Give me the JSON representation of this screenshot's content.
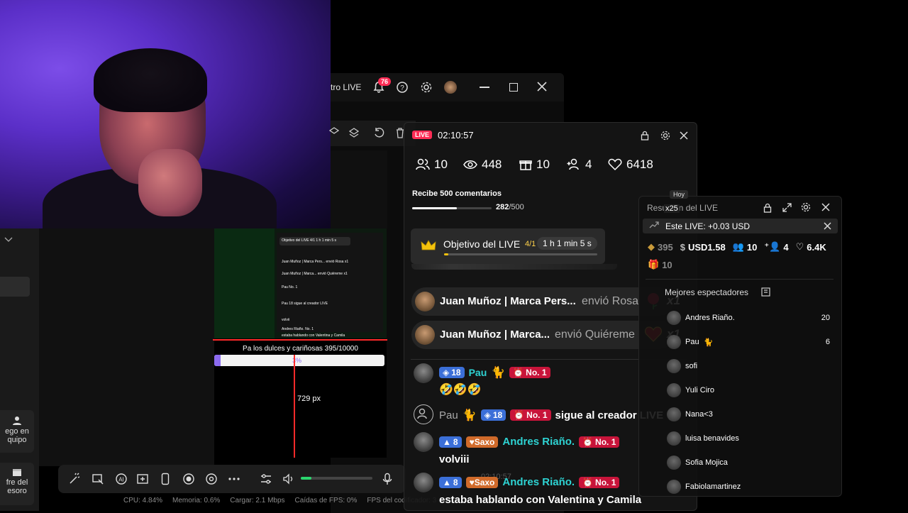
{
  "studio": {
    "topbar_title": "tro LIVE",
    "notification_count": "76"
  },
  "left_panel": {
    "btn_game": "ego en quipo",
    "btn_treasure": "fre del esoro"
  },
  "preview": {
    "goal_text": "Pa los dulces y cariñosas 395/10000",
    "goal_pct": "3%",
    "px_label": "729 px",
    "mini_chat": [
      "Objetivo del LIVE 4/1 1 h 1 min 5 s",
      "Juan Muñoz | Marca Pers... envió Rosa x1",
      "Juan Muñoz | Marca... envió Quiéreme x1",
      "Pau No. 1",
      "Pau 18 sigue al creador LIVE",
      "volvii",
      "Andres Riaño. No. 1",
      "estaba hablando con Valentina y Camila"
    ]
  },
  "status_bar": {
    "cpu": "CPU: 4.84%",
    "memory": "Memoria: 0.6%",
    "upload": "Cargar: 2.1 Mbps",
    "fps_drops": "Caídas de FPS: 0%",
    "encoder_fps": "FPS del codificador: 3"
  },
  "stats_overlay": {
    "live_label": "LIVE",
    "timer": "02:10:57",
    "viewers": "10",
    "views": "448",
    "gifts": "10",
    "followers": "4",
    "likes": "6418",
    "goal_title": "Recibe 500 comentarios",
    "goal_progress": "282",
    "goal_total": "/500",
    "goal_fraction": 0.564,
    "objective_label": "Objetivo del LIVE",
    "objective_count": "4/1",
    "objective_time": "1 h 1 min 5 s",
    "ghost_timer": "02:10:57"
  },
  "chat": {
    "gift1": {
      "user": "Juan Muñoz | Marca Pers...",
      "action": "envió Rosa",
      "count": "x1"
    },
    "gift2": {
      "user": "Juan Muñoz | Marca...",
      "action": "envió Quiéreme",
      "count": "x1"
    },
    "msg1": {
      "level": "18",
      "user": "Pau",
      "rank": "No. 1",
      "text": "🤣🤣🤣"
    },
    "follow": {
      "user": "Pau",
      "level": "18",
      "rank": "No. 1",
      "text": "sigue al creador LIVE"
    },
    "msg2": {
      "level": "8",
      "club": "Saxo",
      "user": "Andres Riaño.",
      "rank": "No. 1",
      "text": "volviii"
    },
    "msg3": {
      "level": "8",
      "club": "Saxo",
      "user": "Andres Riaño.",
      "rank": "No. 1",
      "text": "estaba hablando con Valentina y Camila"
    }
  },
  "summary": {
    "hoy": "Hoy",
    "title": "Resumen del LIVE",
    "x25": "x25",
    "earning_label": "Este LIVE: +0.03 USD",
    "diamonds": "395",
    "usd": "USD1.58",
    "viewers": "10",
    "followers": "4",
    "likes": "6.4K",
    "gifts": "10",
    "top_viewers_label": "Mejores espectadores",
    "viewers_list": [
      {
        "name": "Andres Riaño.",
        "score": "20"
      },
      {
        "name": "Pau",
        "score": "6"
      },
      {
        "name": "sofi",
        "score": ""
      },
      {
        "name": "Yuli Ciro",
        "score": ""
      },
      {
        "name": "Nana<3",
        "score": ""
      },
      {
        "name": "luisa benavides",
        "score": ""
      },
      {
        "name": "Sofia Mojica",
        "score": ""
      },
      {
        "name": "Fabiolamartinez",
        "score": ""
      }
    ]
  },
  "colors": {
    "accent": "#fe2c55",
    "level_badge": "#3b6fd8",
    "cyan_name": "#2ed3d3",
    "goal_fill": "#8c6bf0"
  }
}
